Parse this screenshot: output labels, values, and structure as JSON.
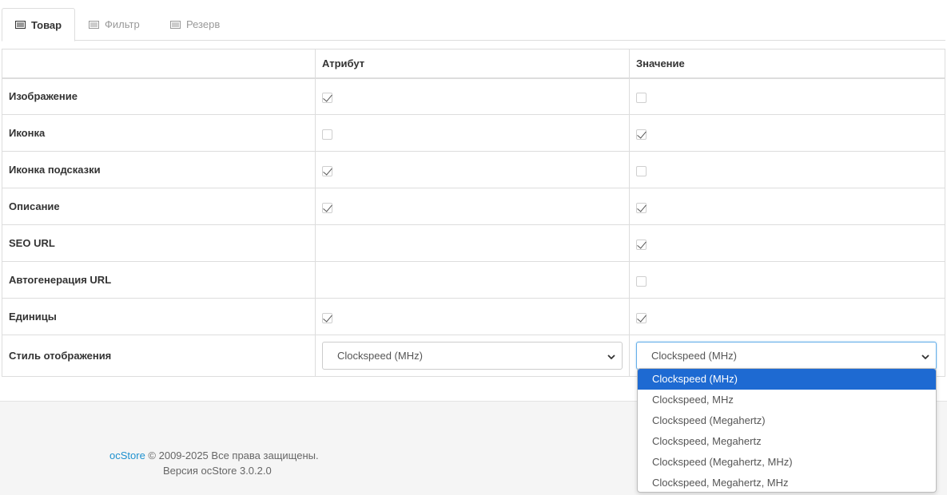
{
  "tabs": [
    {
      "label": "Товар",
      "active": true,
      "icon": "list-icon"
    },
    {
      "label": "Фильтр",
      "active": false,
      "icon": "list-icon"
    },
    {
      "label": "Резерв",
      "active": false,
      "icon": "list-icon"
    }
  ],
  "table": {
    "headers": [
      "",
      "Атрибут",
      "Значение"
    ],
    "rows": [
      {
        "label": "Изображение",
        "attribute": true,
        "value": false
      },
      {
        "label": "Иконка",
        "attribute": false,
        "value": true
      },
      {
        "label": "Иконка подсказки",
        "attribute": true,
        "value": false
      },
      {
        "label": "Описание",
        "attribute": true,
        "value": true
      },
      {
        "label": "SEO URL",
        "attribute": null,
        "value": true
      },
      {
        "label": "Автогенерация URL",
        "attribute": null,
        "value": false
      },
      {
        "label": "Единицы",
        "attribute": true,
        "value": true
      }
    ],
    "display_style": {
      "label": "Стиль отображения",
      "attribute_select": "Clockspeed (MHz)",
      "value_select": "Clockspeed (MHz)"
    }
  },
  "dropdown": {
    "options": [
      "Clockspeed (MHz)",
      "Clockspeed, MHz",
      "Clockspeed (Megahertz)",
      "Clockspeed, Megahertz",
      "Clockspeed (Megahertz, MHz)",
      "Clockspeed, Megahertz, MHz"
    ],
    "selected_index": 0
  },
  "footer": {
    "brand": "ocStore",
    "copyright": " © 2009-2025 Все права защищены.",
    "version": "Версия ocStore 3.0.2.0"
  },
  "colors": {
    "accent": "#1e91cf",
    "selected_option": "#1e6ad2",
    "border": "#dddddd"
  }
}
